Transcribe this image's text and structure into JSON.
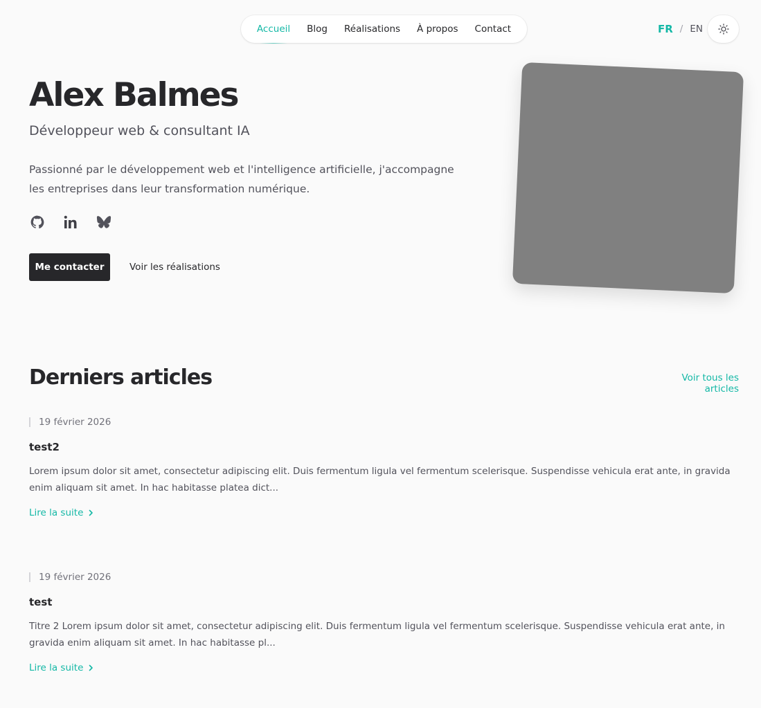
{
  "nav": {
    "items": [
      {
        "label": "Accueil",
        "active": true
      },
      {
        "label": "Blog"
      },
      {
        "label": "Réalisations"
      },
      {
        "label": "À propos"
      },
      {
        "label": "Contact"
      }
    ]
  },
  "lang": {
    "fr": "FR",
    "sep": "/",
    "en": "EN"
  },
  "theme_icon": "sun-icon",
  "hero": {
    "name": "Alex Balmes",
    "role": "Développeur web & consultant IA",
    "description": "Passionné par le développement web et l'intelligence artificielle, j'accompagne les entreprises dans leur transformation numérique.",
    "socials": [
      "github-icon",
      "linkedin-icon",
      "bluesky-icon"
    ],
    "cta_primary": "Me contacter",
    "cta_secondary": "Voir les réalisations"
  },
  "articles_section": {
    "title": "Derniers articles",
    "all_link": "Voir tous les articles",
    "items": [
      {
        "date": "19 février 2026",
        "title": "test2",
        "excerpt": "Lorem ipsum dolor sit amet, consectetur adipiscing elit. Duis fermentum ligula vel fermentum scelerisque. Suspendisse vehicula erat ante, in gravida enim aliquam sit amet. In hac habitasse platea dict...",
        "more": "Lire la suite"
      },
      {
        "date": "19 février 2026",
        "title": "test",
        "excerpt": "Titre 2 Lorem ipsum dolor sit amet, consectetur adipiscing elit. Duis fermentum ligula vel fermentum scelerisque. Suspendisse vehicula erat ante, in gravida enim aliquam sit amet. In hac habitasse pl...",
        "more": "Lire la suite"
      }
    ]
  },
  "colors": {
    "accent": "#14b8a6",
    "text": "#27272a",
    "muted": "#52525b",
    "photo_placeholder": "#808080"
  }
}
